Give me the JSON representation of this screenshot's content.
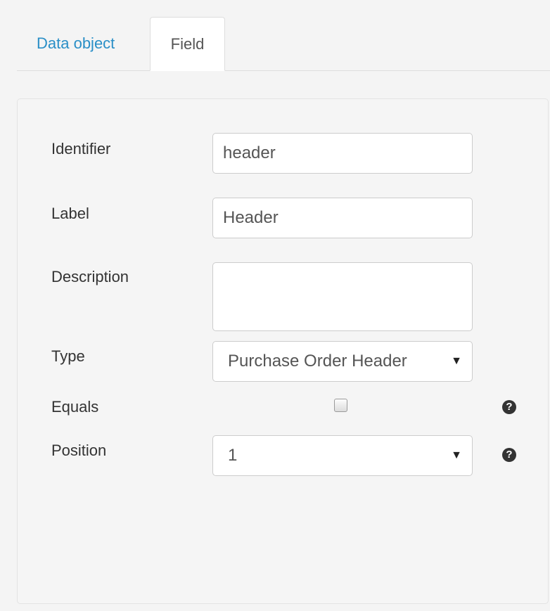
{
  "tabs": [
    {
      "label": "Data object"
    },
    {
      "label": "Field"
    }
  ],
  "form": {
    "identifier": {
      "label": "Identifier",
      "value": "header"
    },
    "label": {
      "label": "Label",
      "value": "Header"
    },
    "description": {
      "label": "Description",
      "value": ""
    },
    "type": {
      "label": "Type",
      "value": "Purchase Order Header"
    },
    "equals": {
      "label": "Equals",
      "checked": false
    },
    "position": {
      "label": "Position",
      "value": "1"
    }
  },
  "icons": {
    "help": "?",
    "dropdown": "▼"
  },
  "colors": {
    "link": "#2a8fc7",
    "background": "#f4f4f4",
    "panel": "#f5f5f5"
  }
}
